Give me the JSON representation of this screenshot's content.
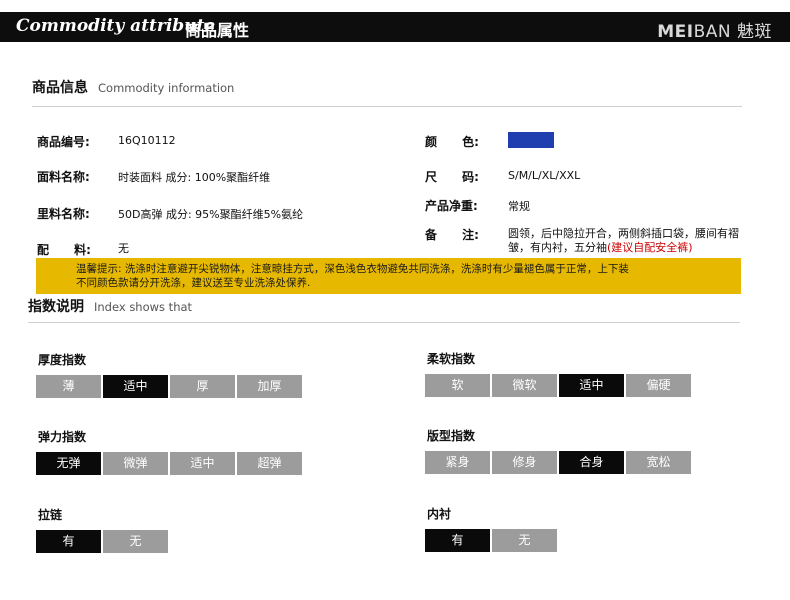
{
  "header": {
    "title_en": "Commodity attribute",
    "title_cn": "商品属性",
    "brand_bold": "MEI",
    "brand_light": "BAN",
    "brand_cn": "魅斑"
  },
  "info": {
    "section_cn": "商品信息",
    "section_en": "Commodity information",
    "code_label": "商品编号:",
    "code_value": "16Q10112",
    "fabric_label": "面料名称:",
    "fabric_value": "时装面料 成分: 100%聚酯纤维",
    "lining_label": "里料名称:",
    "lining_value": "50D高弹 成分: 95%聚酯纤维5%氨纶",
    "accessory_label": "配      料:",
    "accessory_value": "无",
    "color_label": "颜      色:",
    "color_swatch": "#1f3fb0",
    "size_label": "尺      码:",
    "size_value": "S/M/L/XL/XXL",
    "weight_label": "产品净重:",
    "weight_value": "常规",
    "remark_label": "备      注:",
    "remark_value": "圆领，后中隐拉开合，两侧斜插口袋，腰间有褶皱，有内衬，五分袖",
    "remark_warning": "(建议自配安全裤)"
  },
  "notice": {
    "line1": "温馨提示: 洗涤时注意避开尖锐物体，注意晾挂方式，深色浅色衣物避免共同洗涤，洗涤时有少量褪色属于正常，上下装",
    "line2": "不同颜色款请分开洗涤，建议送至专业洗涤处保养."
  },
  "index": {
    "section_cn": "指数说明",
    "section_en": "Index shows that",
    "thickness": {
      "title": "厚度指数",
      "options": [
        "薄",
        "适中",
        "厚",
        "加厚"
      ],
      "selected": "适中"
    },
    "softness": {
      "title": "柔软指数",
      "options": [
        "软",
        "微软",
        "适中",
        "偏硬"
      ],
      "selected": "适中"
    },
    "elasticity": {
      "title": "弹力指数",
      "options": [
        "无弹",
        "微弹",
        "适中",
        "超弹"
      ],
      "selected": "无弹"
    },
    "fit": {
      "title": "版型指数",
      "options": [
        "紧身",
        "修身",
        "合身",
        "宽松"
      ],
      "selected": "合身"
    },
    "zipper": {
      "title": "拉链",
      "options": [
        "有",
        "无"
      ],
      "selected": "有"
    },
    "lining": {
      "title": "内衬",
      "options": [
        "有",
        "无"
      ],
      "selected": "有"
    }
  },
  "colors": {
    "selected_chip": "#0a0a0a",
    "unselected_chip": "#9c9c9c",
    "notice_bg": "#e6b800",
    "warning_text": "#cc0000"
  }
}
